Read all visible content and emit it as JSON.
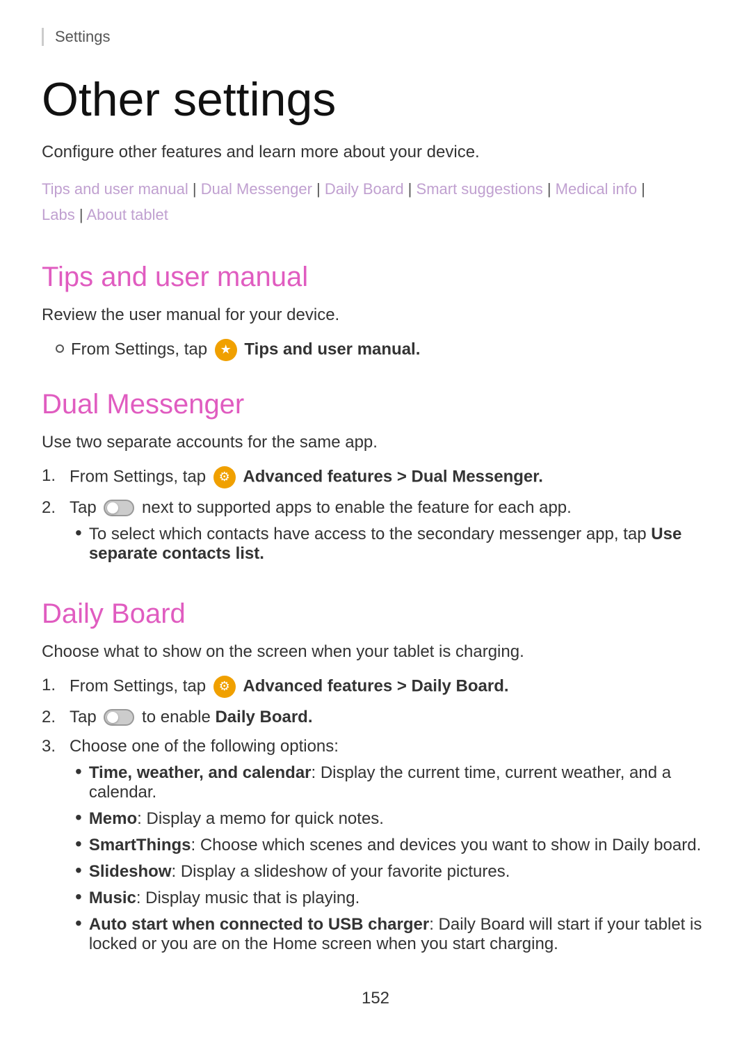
{
  "breadcrumb": "Settings",
  "page": {
    "title": "Other settings",
    "description": "Configure other features and learn more about your device.",
    "nav_links": [
      {
        "label": "Tips and user manual",
        "separator": true
      },
      {
        "label": "Dual Messenger",
        "separator": true
      },
      {
        "label": "Daily Board",
        "separator": true
      },
      {
        "label": "Smart suggestions",
        "separator": true
      },
      {
        "label": "Medical info",
        "separator": true
      },
      {
        "label": "Labs",
        "separator": true
      },
      {
        "label": "About tablet",
        "separator": false
      }
    ]
  },
  "sections": [
    {
      "id": "tips",
      "title": "Tips and user manual",
      "description": "Review the user manual for your device.",
      "bullets": [
        {
          "type": "circle",
          "text": "From Settings, tap",
          "icon": "tips",
          "bold_text": "Tips and user manual."
        }
      ]
    },
    {
      "id": "dual-messenger",
      "title": "Dual Messenger",
      "description": "Use two separate accounts for the same app.",
      "steps": [
        {
          "num": "1.",
          "text": "From Settings, tap",
          "icon": "settings",
          "bold_text": "Advanced features > Dual Messenger."
        },
        {
          "num": "2.",
          "text_before": "Tap",
          "icon": "toggle",
          "text_after": "next to supported apps to enable the feature for each app.",
          "sub_bullets": [
            {
              "text_before": "To select which contacts have access to the secondary messenger app, tap",
              "bold_text": "Use separate contacts list."
            }
          ]
        }
      ]
    },
    {
      "id": "daily-board",
      "title": "Daily Board",
      "description": "Choose what to show on the screen when your tablet is charging.",
      "steps": [
        {
          "num": "1.",
          "text": "From Settings, tap",
          "icon": "settings",
          "bold_text": "Advanced features > Daily Board."
        },
        {
          "num": "2.",
          "text_before": "Tap",
          "icon": "toggle",
          "bold_text": "to enable Daily Board."
        },
        {
          "num": "3.",
          "text": "Choose one of the following options:",
          "sub_bullets": [
            {
              "bold_text": "Time, weather, and calendar",
              "text_after": ": Display the current time, current weather, and a calendar."
            },
            {
              "bold_text": "Memo",
              "text_after": ": Display a memo for quick notes."
            },
            {
              "bold_text": "SmartThings",
              "text_after": ": Choose which scenes and devices you want to show in Daily board."
            },
            {
              "bold_text": "Slideshow",
              "text_after": ": Display a slideshow of your favorite pictures."
            },
            {
              "bold_text": "Music",
              "text_after": ": Display music that is playing."
            },
            {
              "bold_text": "Auto start when connected to USB charger",
              "text_after": ": Daily Board will start if your tablet is locked or you are on the Home screen when you start charging."
            }
          ]
        }
      ]
    }
  ],
  "footer": {
    "page_number": "152"
  }
}
